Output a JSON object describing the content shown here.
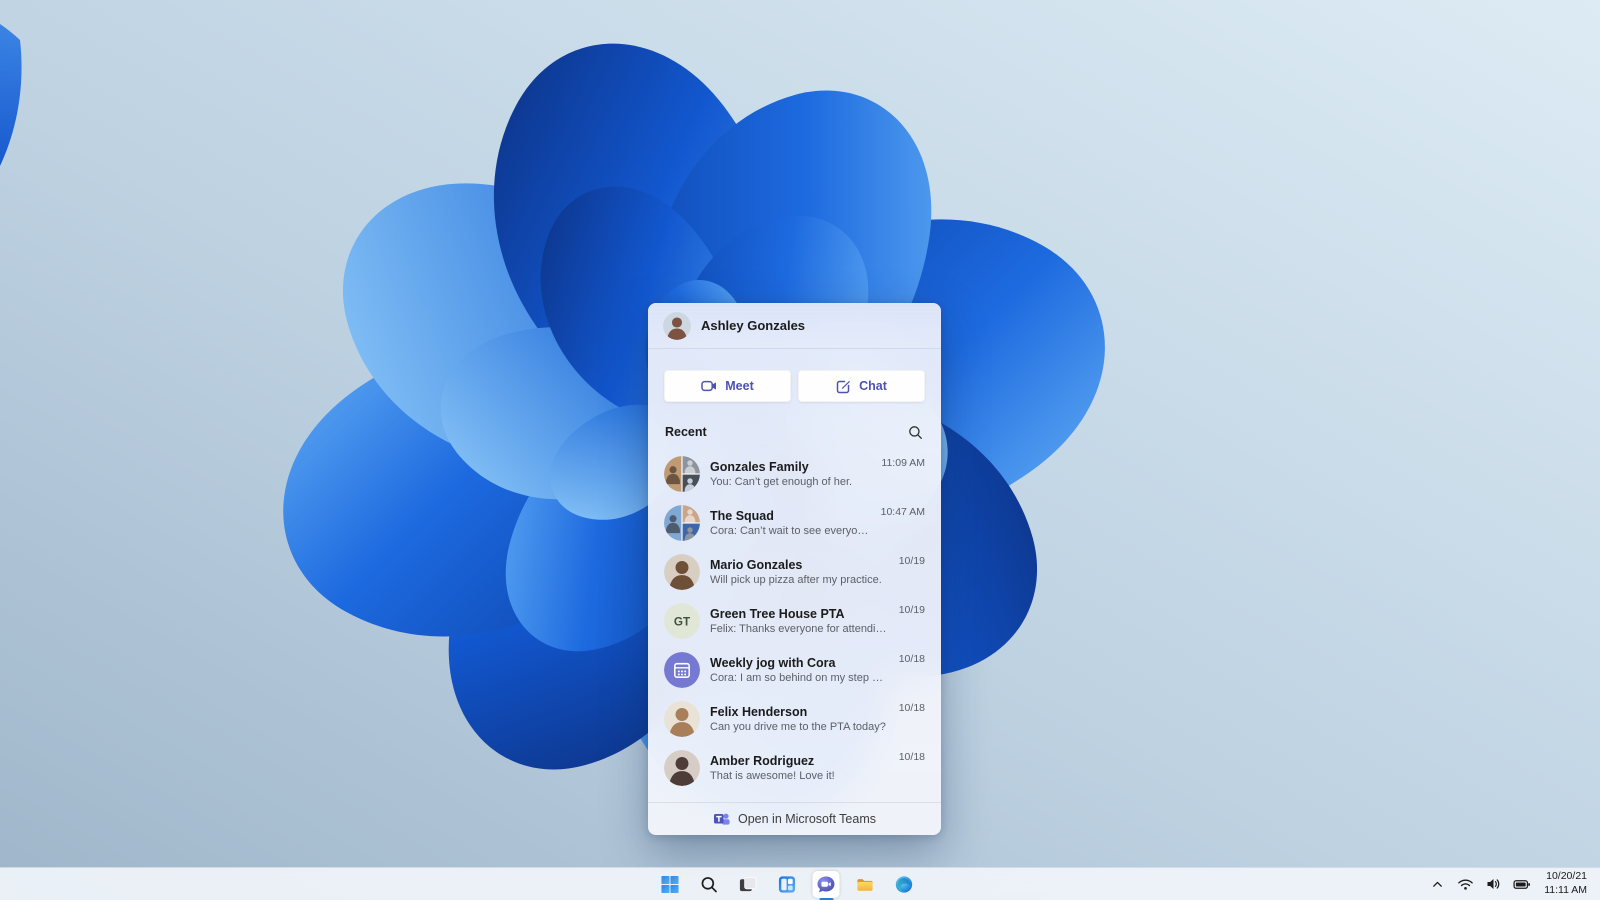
{
  "colors": {
    "accent_purple": "#4F52B2",
    "teams_logo_purple": "#5059C9",
    "teams_logo_light": "#7B83EB",
    "active_indicator_blue": "#2E7BD6",
    "bloom_dark_blue": "#0B3FA6",
    "bloom_light_blue": "#66B1F5",
    "taskbar_bg": "#F0F4FA"
  },
  "flyout": {
    "header": {
      "name": "Ashley Gonzales",
      "avatar": {
        "type": "photo",
        "bg": "#cdd7e2",
        "fg": "#7d5240"
      }
    },
    "actions": {
      "meet_label": "Meet",
      "chat_label": "Chat"
    },
    "recent_title": "Recent",
    "conversations": [
      {
        "name": "Gonzales Family",
        "preview": "You: Can’t get enough of her.",
        "time": "11:09 AM",
        "avatar": {
          "type": "group",
          "colors": [
            "#bf9a72",
            "#8d949e",
            "#4a4f57",
            "#c6d0da"
          ]
        }
      },
      {
        "name": "The Squad",
        "preview": "Cora: Can’t wait to see everyone!",
        "time": "10:47 AM",
        "avatar": {
          "type": "group",
          "colors": [
            "#7fa9d4",
            "#caa58a",
            "#3e66a8",
            "#8f959e"
          ]
        }
      },
      {
        "name": "Mario Gonzales",
        "preview": "Will pick up pizza after my practice.",
        "time": "10/19",
        "avatar": {
          "type": "photo",
          "bg": "#d8cfc2",
          "fg": "#6e4f37"
        }
      },
      {
        "name": "Green Tree House PTA",
        "preview": "Felix: Thanks everyone for attending today.",
        "time": "10/19",
        "avatar": {
          "type": "initials",
          "text": "GT",
          "bg": "#e1e7d6",
          "fg": "#44503f"
        }
      },
      {
        "name": "Weekly jog with Cora",
        "preview": "Cora: I am so behind on my step goals.",
        "time": "10/18",
        "avatar": {
          "type": "icon-calendar",
          "bg": "#7579D1",
          "fg": "#ffffff"
        }
      },
      {
        "name": "Felix Henderson",
        "preview": "Can you drive me to the PTA today?",
        "time": "10/18",
        "avatar": {
          "type": "photo",
          "bg": "#e9e2d6",
          "fg": "#a87f58"
        }
      },
      {
        "name": "Amber Rodriguez",
        "preview": "That is awesome! Love it!",
        "time": "10/18",
        "avatar": {
          "type": "photo",
          "bg": "#d6cdc6",
          "fg": "#4d3c38"
        }
      }
    ],
    "footer_label": "Open in Microsoft Teams"
  },
  "taskbar": {
    "icons": [
      "start",
      "search",
      "task-view",
      "widgets",
      "chat",
      "file-explorer",
      "edge"
    ],
    "active_icon": "chat",
    "tray_icons": [
      "hidden-icons-chevron",
      "wifi",
      "volume",
      "battery"
    ],
    "clock": {
      "date": "10/20/21",
      "time": "11:11 AM"
    }
  }
}
